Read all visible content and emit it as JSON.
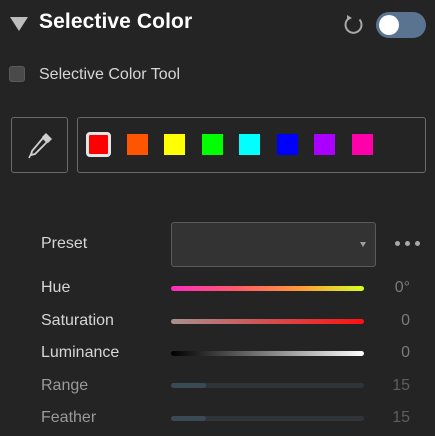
{
  "header": {
    "title": "Selective Color",
    "enabled": true
  },
  "tool_checkbox": {
    "label": "Selective Color Tool",
    "checked": false
  },
  "swatches": [
    {
      "name": "red",
      "color": "#ff0000",
      "selected": true
    },
    {
      "name": "orange",
      "color": "#ff5500",
      "selected": false
    },
    {
      "name": "yellow",
      "color": "#ffff00",
      "selected": false
    },
    {
      "name": "green",
      "color": "#00ff00",
      "selected": false
    },
    {
      "name": "cyan",
      "color": "#00ffff",
      "selected": false
    },
    {
      "name": "blue",
      "color": "#0000ff",
      "selected": false
    },
    {
      "name": "purple",
      "color": "#aa00ff",
      "selected": false
    },
    {
      "name": "magenta",
      "color": "#ff00aa",
      "selected": false
    }
  ],
  "preset": {
    "label": "Preset",
    "value": ""
  },
  "sliders": {
    "hue": {
      "label": "Hue",
      "value": "0°"
    },
    "saturation": {
      "label": "Saturation",
      "value": "0"
    },
    "luminance": {
      "label": "Luminance",
      "value": "0"
    },
    "range": {
      "label": "Range",
      "value": "15",
      "fraction": 0.18
    },
    "feather": {
      "label": "Feather",
      "value": "15",
      "fraction": 0.18
    }
  },
  "icons": {
    "collapse": "triangle-down-icon",
    "reset": "reset-icon",
    "eyedropper": "eyedropper-icon",
    "more": "more-icon"
  }
}
